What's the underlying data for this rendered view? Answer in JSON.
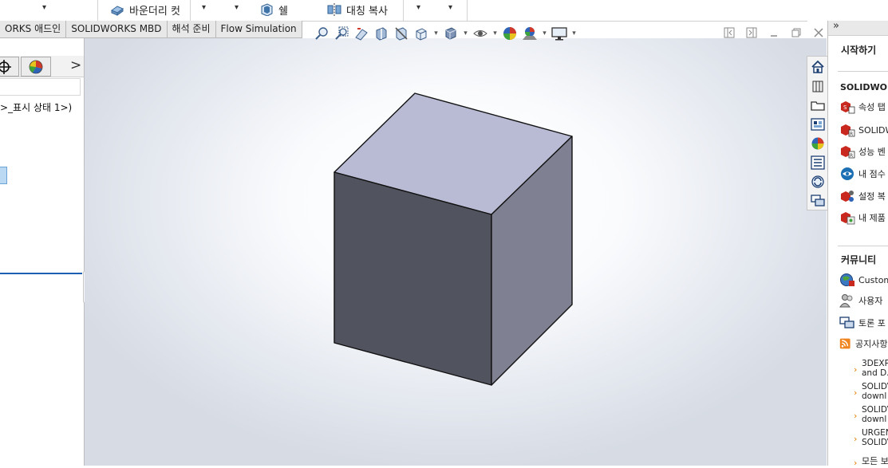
{
  "ribbon": {
    "boundary_cut": "바운더리 컷",
    "shell": "쉘",
    "mirror_copy": "대칭 복사"
  },
  "tabs": [
    {
      "label": "ORKS 애드인"
    },
    {
      "label": "SOLIDWORKS MBD"
    },
    {
      "label": "해석 준비"
    },
    {
      "label": "Flow Simulation"
    }
  ],
  "left_panel": {
    "tree_text": ">_표시 상태 1>)",
    "more_chevron": ">"
  },
  "task_pane": {
    "collapse": "»",
    "getting_started_title": "시작하기",
    "solidworks_title": "SOLIDWORK",
    "solidworks_items": [
      {
        "label": "속성 탭"
      },
      {
        "label": "SOLIDW"
      },
      {
        "label": "성능 벤"
      },
      {
        "label": "내 점수"
      },
      {
        "label": "설정 복"
      },
      {
        "label": "내 제품"
      }
    ],
    "community_title": "커뮤니티",
    "community_items": [
      {
        "label": "Custom"
      },
      {
        "label": "사용자"
      },
      {
        "label": "토론 포"
      },
      {
        "label": "공지사항"
      }
    ],
    "news": [
      {
        "line1": "3DEXP",
        "line2": "and D."
      },
      {
        "line1": "SOLIDV",
        "line2": "downl"
      },
      {
        "line1": "SOLIDV",
        "line2": "downl"
      },
      {
        "line1": "URGEN",
        "line2": "SOLIDV"
      }
    ],
    "more_label": "모든 보"
  },
  "colors": {
    "cube_top": "#b8bbd3",
    "cube_front": "#51535f",
    "cube_side": "#7f8092",
    "accent_blue": "#1d5fb3"
  }
}
